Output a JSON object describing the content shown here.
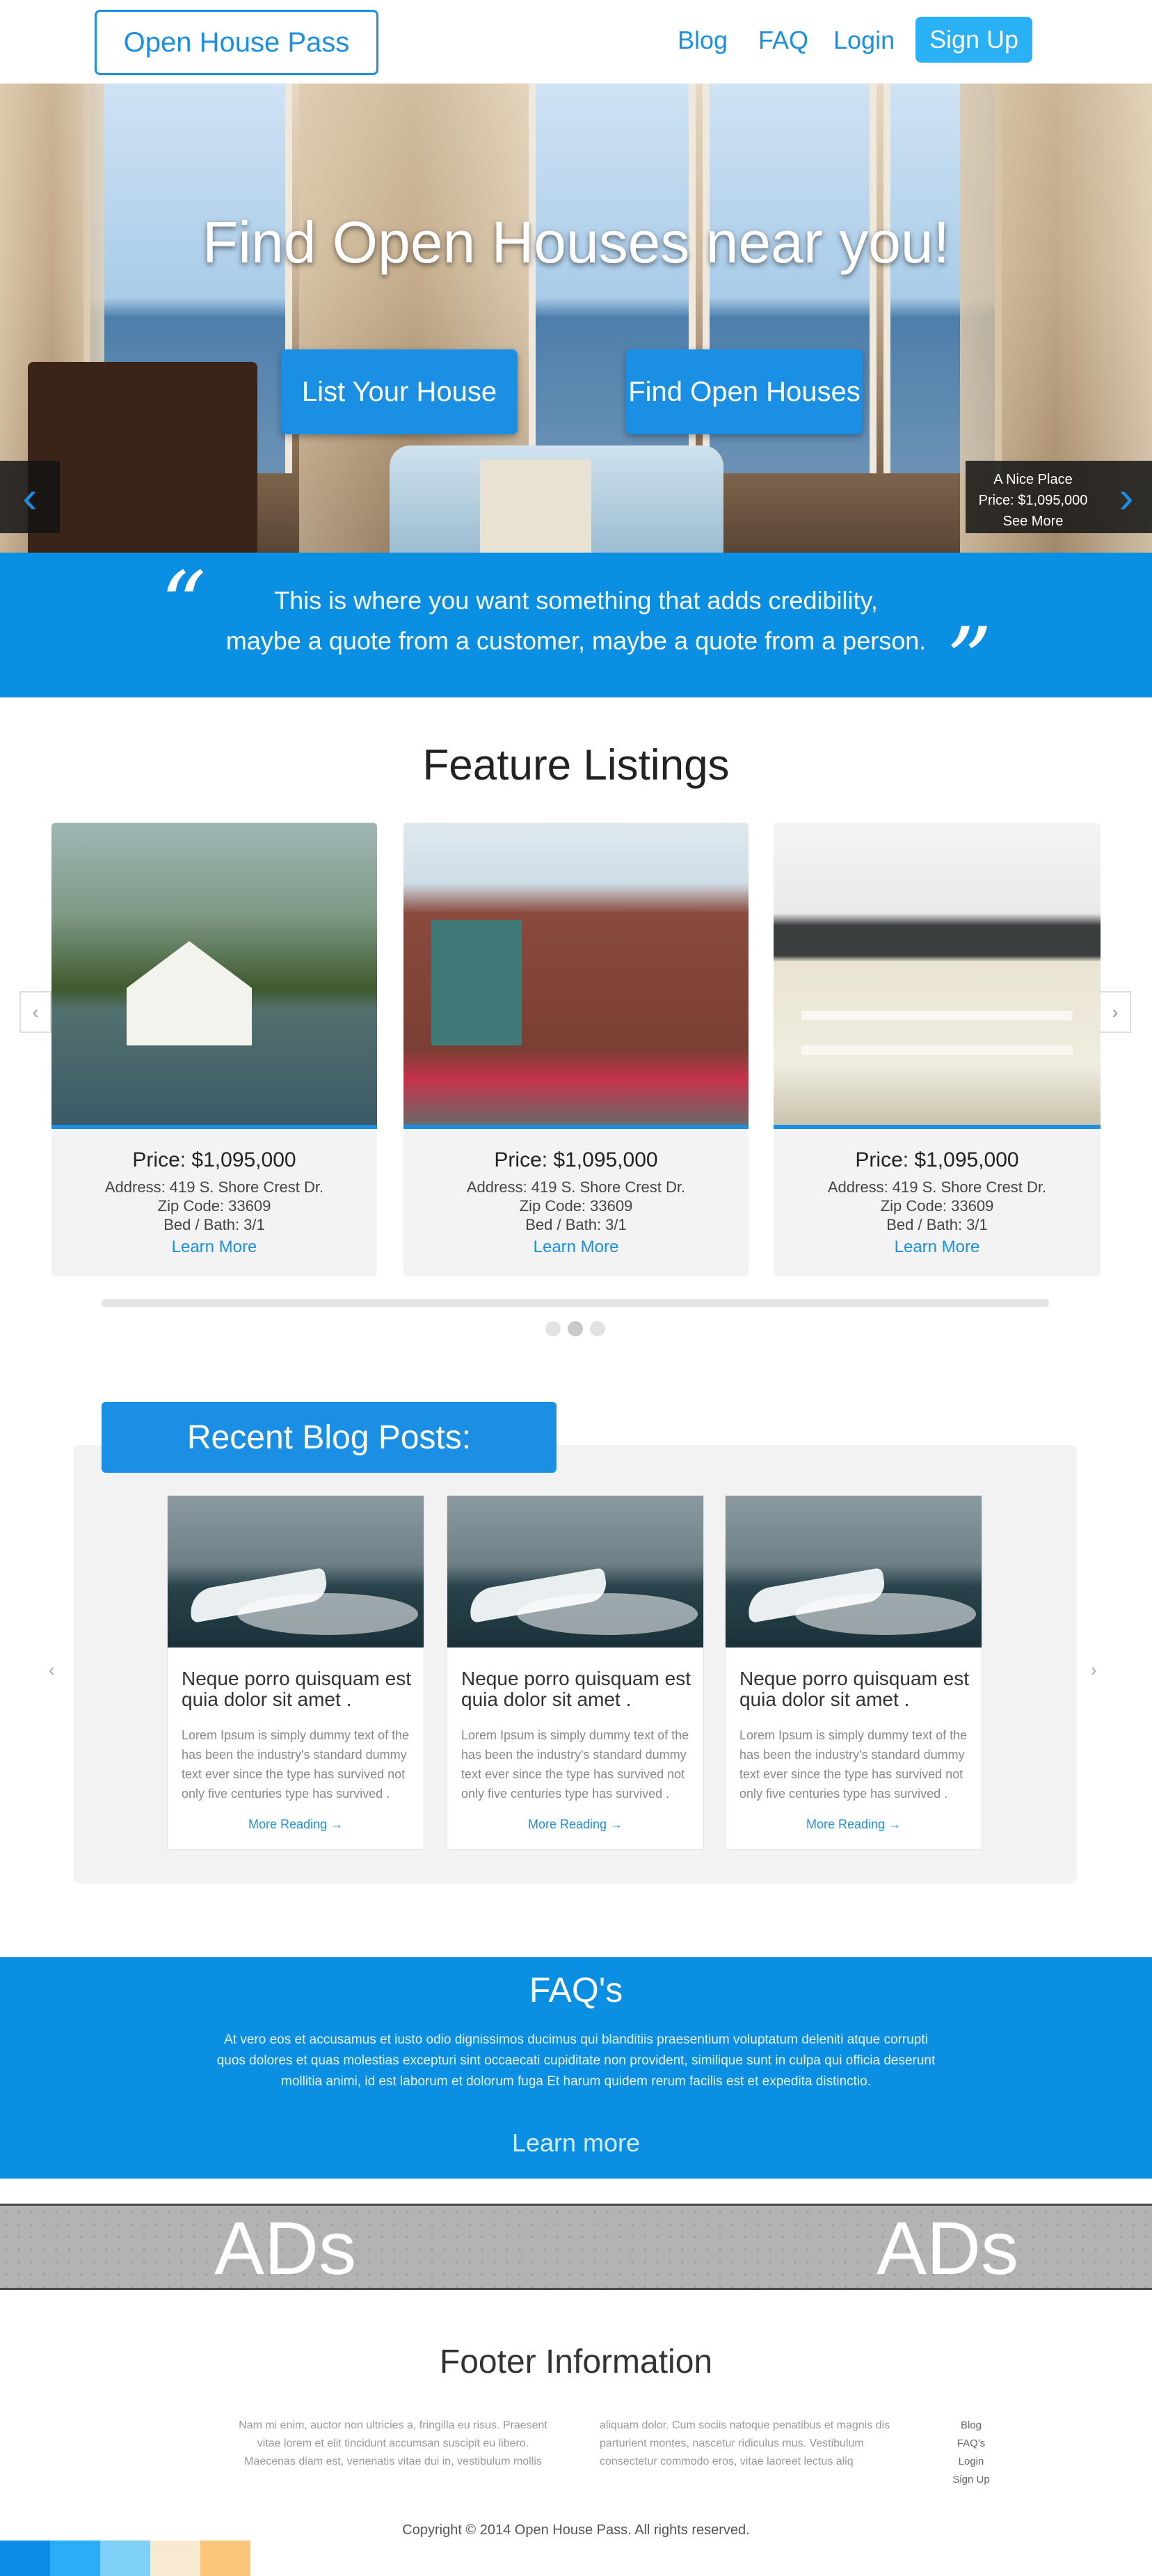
{
  "header": {
    "logo": "Open House Pass",
    "nav": [
      "Blog",
      "FAQ",
      "Login"
    ],
    "signup": "Sign Up"
  },
  "hero": {
    "title": "Find Open Houses near you!",
    "buttons": [
      "List Your House",
      "Find Open Houses"
    ],
    "listing_tip": {
      "name": "A Nice Place",
      "price": "Price: $1,095,000",
      "cta": "See More"
    },
    "prev_arrow": "‹",
    "next_arrow": "›"
  },
  "quote": {
    "line1": "This is where you want something that adds credibility,",
    "line2": "maybe a quote from a customer, maybe a quote from a person.",
    "open_mark": "“",
    "close_mark": "”"
  },
  "features": {
    "title": "Feature Listings",
    "cards": [
      {
        "price": "Price: $1,095,000",
        "address": "Address: 419 S. Shore Crest Dr.",
        "zip": "Zip Code: 33609",
        "bed_bath": "Bed / Bath: 3/1",
        "more": "Learn More"
      },
      {
        "price": "Price: $1,095,000",
        "address": "Address: 419 S. Shore Crest Dr.",
        "zip": "Zip Code: 33609",
        "bed_bath": "Bed / Bath: 3/1",
        "more": "Learn More"
      },
      {
        "price": "Price: $1,095,000",
        "address": "Address: 419 S. Shore Crest Dr.",
        "zip": "Zip Code: 33609",
        "bed_bath": "Bed / Bath: 3/1",
        "more": "Learn More"
      }
    ],
    "prev": "‹",
    "next": "›"
  },
  "blog": {
    "title": "Recent Blog Posts:",
    "posts": [
      {
        "title": "Neque porro quisquam est quia dolor sit amet .",
        "text": "Lorem Ipsum is simply dummy text of the has been the industry's standard dummy text ever since the type has survived not only five centuries type has survived .",
        "more": "More Reading →"
      },
      {
        "title": "Neque porro quisquam est quia dolor sit amet .",
        "text": "Lorem Ipsum is simply dummy text of the has been the industry's standard dummy text ever since the type has survived not only five centuries type has survived .",
        "more": "More Reading →"
      },
      {
        "title": "Neque porro quisquam est quia dolor sit amet .",
        "text": "Lorem Ipsum is simply dummy text of the has been the industry's standard dummy text ever since the type has survived not only five centuries type has survived .",
        "more": "More Reading →"
      }
    ],
    "prev": "‹",
    "next": "›"
  },
  "faq": {
    "title": "FAQ's",
    "text": "At vero eos et accusamus et iusto odio dignissimos ducimus qui blanditiis praesentium voluptatum deleniti atque corrupti quos dolores et quas molestias excepturi sint occaecati cupiditate non provident, similique sunt in culpa qui officia deserunt mollitia animi, id est laborum et dolorum fuga Et harum quidem rerum facilis est et expedita distinctio.",
    "more": "Learn more"
  },
  "ads": [
    "ADs",
    "ADs"
  ],
  "footer": {
    "title": "Footer Information",
    "col1": "Nam mi enim, auctor non ultricies a, fringilla eu risus. Praesent vitae lorem et elit tincidunt accumsan suscipit eu libero. Maecenas diam est, venenatis vitae dui in, vestibulum mollis",
    "col2": "aliquam dolor. Cum sociis natoque penatibus et magnis dis parturient montes, nascetur ridiculus mus. Vestibulum consectetur commodo eros, vitae laoreet lectus aliq",
    "links": [
      "Blog",
      "FAQ's",
      "Login",
      "Sign Up"
    ],
    "copyright": "Copyright © 2014  Open House Pass.  All rights reserved."
  },
  "colors": {
    "brand_blue": "#1a8fe3",
    "light_blue": "#29b0f5",
    "swatches": [
      "#0d8de6",
      "#2aaef5",
      "#7fd0f8",
      "#f7ead0",
      "#fbc57a"
    ]
  }
}
